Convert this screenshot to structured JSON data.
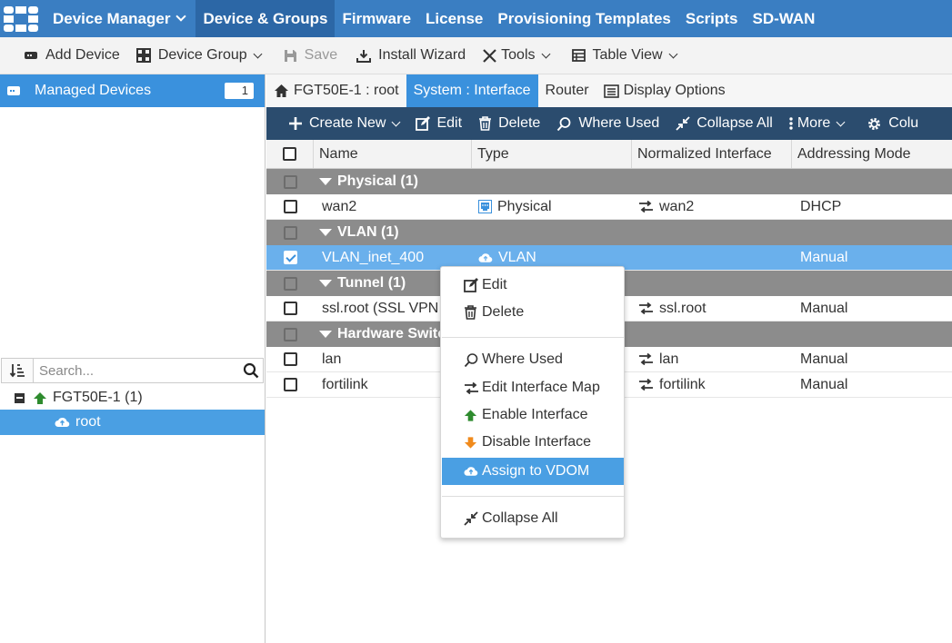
{
  "topnav": {
    "app_label": "Device Manager",
    "tabs": [
      {
        "label": "Device & Groups",
        "active": true
      },
      {
        "label": "Firmware"
      },
      {
        "label": "License"
      },
      {
        "label": "Provisioning Templates"
      },
      {
        "label": "Scripts"
      },
      {
        "label": "SD-WAN"
      }
    ],
    "colors": {
      "bar": "#3a7ec2",
      "active": "#2c67a6"
    }
  },
  "toolbar": {
    "add_device": "Add Device",
    "device_group": "Device Group",
    "save": "Save",
    "install_wizard": "Install Wizard",
    "tools": "Tools",
    "table_view": "Table View"
  },
  "left_panel": {
    "managed_devices": {
      "label": "Managed Devices",
      "count": "1"
    },
    "search": {
      "placeholder": "Search..."
    },
    "tree": {
      "device": "FGT50E-1 (1)",
      "vdom": "root"
    }
  },
  "subtabs": {
    "context": "FGT50E-1 : root",
    "system_interface": "System : Interface",
    "router": "Router",
    "display_options": "Display Options"
  },
  "table_toolbar": {
    "create_new": "Create New",
    "edit": "Edit",
    "delete": "Delete",
    "where_used": "Where Used",
    "collapse_all": "Collapse All",
    "more": "More",
    "columns": "Colu"
  },
  "table": {
    "headers": {
      "name": "Name",
      "type": "Type",
      "normalized": "Normalized Interface",
      "addressing": "Addressing Mode"
    },
    "groups": [
      {
        "label": "Physical (1)"
      },
      {
        "label": "VLAN (1)"
      },
      {
        "label": "Tunnel (1)"
      },
      {
        "label": "Hardware Switch (2)"
      }
    ],
    "rows": [
      {
        "name": "wan2",
        "type": "Physical",
        "normalized": "wan2",
        "mode": "DHCP"
      },
      {
        "name": "VLAN_inet_400",
        "type": "VLAN",
        "normalized": "",
        "mode": "Manual"
      },
      {
        "name": "ssl.root (SSL VPN interface)",
        "type": "",
        "normalized": "ssl.root",
        "mode": "Manual"
      },
      {
        "name": "lan",
        "type": "",
        "normalized": "lan",
        "mode": "Manual"
      },
      {
        "name": "fortilink",
        "type": "",
        "normalized": "fortilink",
        "mode": "Manual"
      }
    ]
  },
  "context_menu": {
    "edit": "Edit",
    "delete": "Delete",
    "where_used": "Where Used",
    "edit_interface_map": "Edit Interface Map",
    "enable_interface": "Enable Interface",
    "disable_interface": "Disable Interface",
    "assign_vdom": "Assign to VDOM",
    "collapse_all": "Collapse All"
  }
}
